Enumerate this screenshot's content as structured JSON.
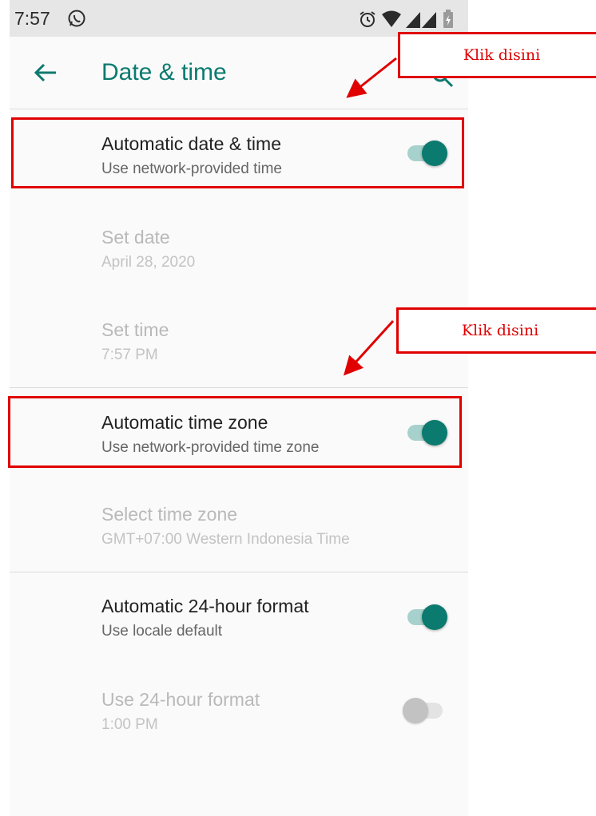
{
  "status_bar": {
    "time": "7:57",
    "icons": [
      "whatsapp-icon",
      "alarm-icon",
      "wifi-icon",
      "signal-icon",
      "battery-icon"
    ]
  },
  "app_bar": {
    "title": "Date & time",
    "back_icon": "arrow-left-icon",
    "search_icon": "search-icon"
  },
  "settings": {
    "auto_date_time": {
      "title": "Automatic date & time",
      "summary": "Use network-provided time",
      "enabled": true
    },
    "set_date": {
      "title": "Set date",
      "summary": "April 28, 2020"
    },
    "set_time": {
      "title": "Set time",
      "summary": "7:57 PM"
    },
    "auto_time_zone": {
      "title": "Automatic time zone",
      "summary": "Use network-provided time zone",
      "enabled": true
    },
    "select_time_zone": {
      "title": "Select time zone",
      "summary": "GMT+07:00 Western Indonesia Time"
    },
    "auto_24_hour": {
      "title": "Automatic 24-hour format",
      "summary": "Use locale default",
      "enabled": true
    },
    "use_24_hour": {
      "title": "Use 24-hour format",
      "summary": "1:00 PM",
      "enabled": false
    }
  },
  "annotations": {
    "callout_1": "Klik disini",
    "callout_2": "Klik disini",
    "color": "#e00000"
  },
  "colors": {
    "accent": "#0b7a6f",
    "track_on": "#a7d1cc",
    "background": "#fafafa",
    "status_bar": "#e6e6e6"
  }
}
